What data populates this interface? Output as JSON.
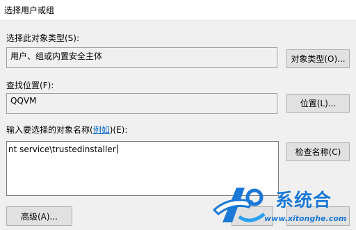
{
  "window": {
    "title": "选择用户或组"
  },
  "object_type": {
    "label": "选择此对象类型(S):",
    "value": "用户、组或内置安全主体",
    "button": "对象类型(O)..."
  },
  "location": {
    "label": "查找位置(F):",
    "value": "QQVM",
    "button": "位置(L)..."
  },
  "names": {
    "label_pre": "输入要选择的对象名称(",
    "label_link": "例如",
    "label_post": ")(E):",
    "value": "nt service\\trustedinstaller",
    "check_button": "检查名称(C)"
  },
  "footer": {
    "advanced_button": "高级(A)..."
  },
  "watermark": {
    "text": "系统合",
    "url": "www.xitonghe.com"
  },
  "colors": {
    "accent": "#1b78d6",
    "link": "#0066cc"
  }
}
